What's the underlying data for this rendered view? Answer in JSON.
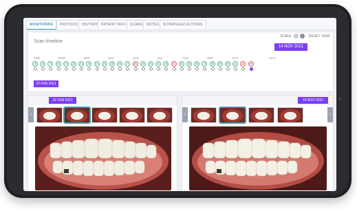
{
  "tabs": [
    "MONITORING",
    "PROTOCOL",
    "HISTORY",
    "PATIENT INFO",
    "SCANS",
    "NOTES",
    "SCHEDULED ACTIONS"
  ],
  "timeline": {
    "title": "Scan timeline",
    "scale_label": "SCALE",
    "reset_label": "RESET VIEW",
    "right_selected_date": "14 NOV 2021",
    "left_selected_date": "22 FEB 2021",
    "months": [
      "FEB",
      "MAR",
      "APR",
      "MAY",
      "JUN",
      "JUL",
      "AUG",
      "SEP",
      "OCT",
      "NOV"
    ],
    "scan_numbers": [
      "15",
      "16",
      "17",
      "18",
      "19",
      "20",
      "21",
      "22",
      "23",
      "24",
      "25",
      "26",
      "27",
      "28",
      "29",
      "30",
      "31",
      "32",
      "33",
      "34",
      "35",
      "36",
      "37",
      "38",
      "39",
      "40",
      "41",
      "42",
      "43"
    ],
    "flagged_numbers": [
      "28",
      "33",
      "42",
      "43"
    ]
  },
  "left_panel": {
    "date": "22 FEB 2021"
  },
  "right_panel": {
    "date": "14 NOV 2021"
  },
  "colors": {
    "accent_purple": "#7b3ff2",
    "accent_teal": "#3e9db4",
    "scan_ok": "#4fb88a",
    "scan_flag": "#e05a5a"
  }
}
